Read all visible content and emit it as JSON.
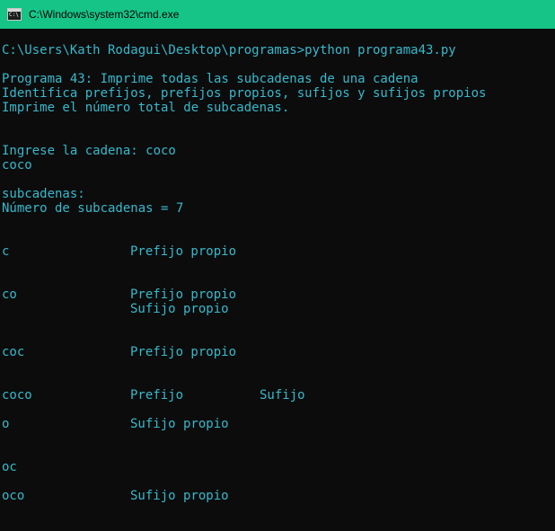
{
  "window": {
    "title": "C:\\Windows\\system32\\cmd.exe",
    "titlebar_color": "#16c488",
    "text_color": "#38b9cc",
    "background": "#0c0c0c"
  },
  "console": {
    "prompt": "C:\\Users\\Kath Rodagui\\Desktop\\programas>python programa43.py",
    "header": [
      "Programa 43: Imprime todas las subcadenas de una cadena",
      "Identifica prefijos, prefijos propios, sufijos y sufijos propios",
      "Imprime el número total de subcadenas."
    ],
    "input_prompt": "Ingrese la cadena: coco",
    "echo": "coco",
    "subcadenas_label": "subcadenas:",
    "count_line": "Número de subcadenas = 7",
    "results": [
      {
        "sub": "c",
        "col2": "Prefijo propio",
        "col3": "",
        "extra": ""
      },
      {
        "sub": "co",
        "col2": "Prefijo propio",
        "col3": "",
        "extra": "Sufijo propio"
      },
      {
        "sub": "coc",
        "col2": "Prefijo propio",
        "col3": "",
        "extra": ""
      },
      {
        "sub": "coco",
        "col2": "Prefijo",
        "col3": "Sufijo",
        "extra": ""
      },
      {
        "sub": "o",
        "col2": "Sufijo propio",
        "col3": "",
        "extra": ""
      },
      {
        "sub": "oc",
        "col2": "",
        "col3": "",
        "extra": ""
      },
      {
        "sub": "oco",
        "col2": "Sufijo propio",
        "col3": "",
        "extra": ""
      }
    ]
  }
}
